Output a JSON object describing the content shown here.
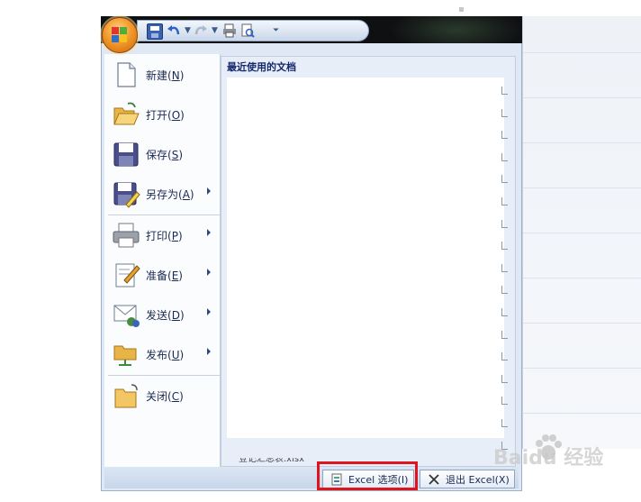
{
  "quick_access": {
    "icons": [
      "save-icon",
      "undo-icon",
      "redo-icon",
      "print-preview-icon",
      "customize-dropdown-icon"
    ]
  },
  "office_button": {
    "icon": "office-logo-icon"
  },
  "menu": {
    "items": [
      {
        "key": "new",
        "label": "新建",
        "accel": "(N)",
        "accel_letter": "N",
        "icon": "new-document-icon",
        "has_submenu": false
      },
      {
        "key": "open",
        "label": "打开",
        "accel": "(O)",
        "accel_letter": "O",
        "icon": "open-folder-icon",
        "has_submenu": false
      },
      {
        "key": "save",
        "label": "保存",
        "accel": "(S)",
        "accel_letter": "S",
        "icon": "save-disk-icon",
        "has_submenu": false
      },
      {
        "key": "saveas",
        "label": "另存为",
        "accel": "(A)",
        "accel_letter": "A",
        "icon": "save-as-icon",
        "has_submenu": true
      },
      {
        "key": "print",
        "label": "打印",
        "accel": "(P)",
        "accel_letter": "P",
        "icon": "printer-icon",
        "has_submenu": true
      },
      {
        "key": "prepare",
        "label": "准备",
        "accel": "(E)",
        "accel_letter": "E",
        "icon": "prepare-document-icon",
        "has_submenu": true
      },
      {
        "key": "send",
        "label": "发送",
        "accel": "(D)",
        "accel_letter": "D",
        "icon": "send-mail-icon",
        "has_submenu": true
      },
      {
        "key": "publish",
        "label": "发布",
        "accel": "(U)",
        "accel_letter": "U",
        "icon": "publish-folder-icon",
        "has_submenu": true
      },
      {
        "key": "close",
        "label": "关闭",
        "accel": "(C)",
        "accel_letter": "C",
        "icon": "close-folder-icon",
        "has_submenu": false
      }
    ]
  },
  "recent": {
    "title": "最近使用的文档",
    "footer_partial": "登记汇总表.xlsx",
    "pin_count": 17
  },
  "buttons": {
    "options": {
      "label": "Excel 选项(I)",
      "icon": "options-icon"
    },
    "exit": {
      "label": "退出 Excel(X)",
      "icon": "exit-x-icon"
    }
  },
  "highlight": {
    "target": "options-button",
    "color": "#e0141e"
  },
  "watermark": {
    "text": "Baidu 经验"
  },
  "colors": {
    "accent": "#15286d",
    "frame": "#dfe8f4",
    "highlight": "#e0141e"
  }
}
